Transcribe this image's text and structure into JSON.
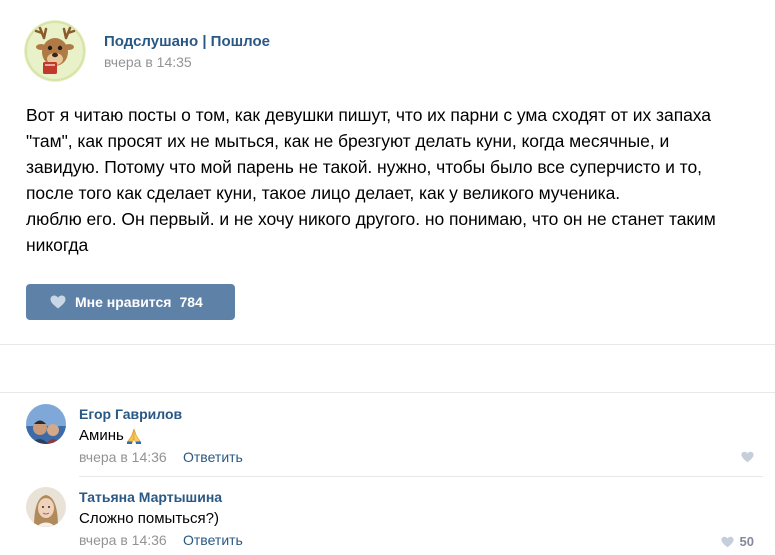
{
  "post": {
    "group_name": "Подслушано | Пошлое",
    "date": "вчера в 14:35",
    "text": "Вот я читаю посты о том, как девушки пишут, что их парни с ума сходят от их запаха\n\"там\", как просят их не мыться, как не брезгуют делать куни, когда месячные, и\nзавидую. Потому что мой парень не такой. нужно, чтобы было все суперчисто и то,\nпосле того как сделает куни, такое лицо делает, как у великого мученика.\nлюблю его. Он первый. и не хочу никого другого. но понимаю, что он не станет таким\nникогда",
    "like_label": "Мне нравится",
    "like_count": "784"
  },
  "comments": [
    {
      "author": "Егор Гаврилов",
      "text": "Аминь",
      "emoji": "praying-hands-icon",
      "date": "вчера в 14:36",
      "reply_label": "Ответить",
      "likes": ""
    },
    {
      "author": "Татьяна Мартышина",
      "text": "Сложно помыться?)",
      "date": "вчера в 14:36",
      "reply_label": "Ответить",
      "likes": "50"
    }
  ],
  "colors": {
    "link": "#2a5885",
    "button": "#5e81a8",
    "meta": "#939393",
    "divider": "#e7e8ec"
  }
}
